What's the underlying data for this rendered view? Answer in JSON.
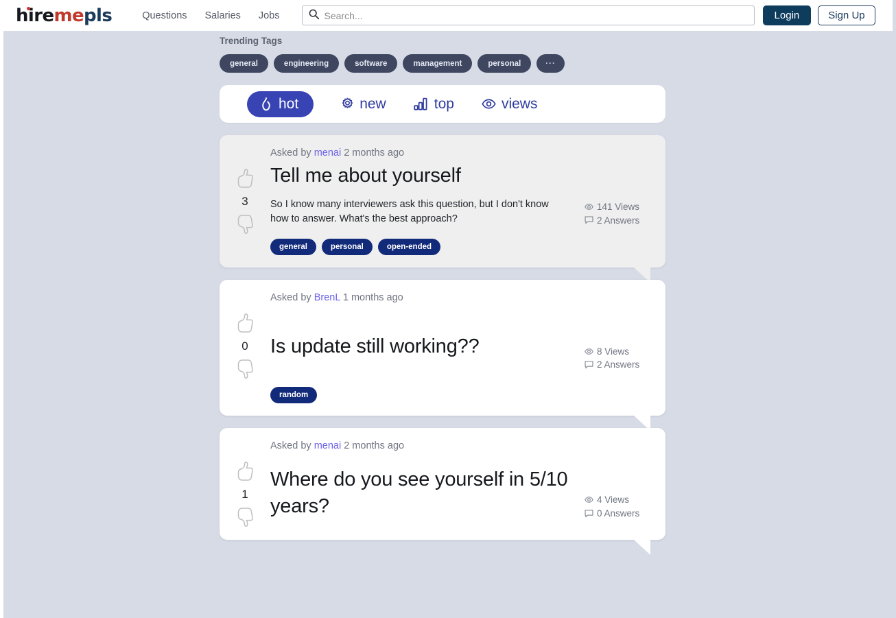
{
  "header": {
    "logo": {
      "part1": "hire",
      "part2": "me",
      "part3": "pls"
    },
    "nav": [
      {
        "label": "Questions"
      },
      {
        "label": "Salaries"
      },
      {
        "label": "Jobs"
      }
    ],
    "search": {
      "placeholder": "Search...",
      "value": "",
      "icon": "search-icon"
    },
    "login_label": "Login",
    "signup_label": "Sign Up",
    "colors": {
      "login_bg": "#0e3c5d",
      "signup_border": "#1b3a5c",
      "accent_red": "#c0392b"
    }
  },
  "trending": {
    "label": "Trending Tags",
    "tags": [
      {
        "label": "general"
      },
      {
        "label": "engineering"
      },
      {
        "label": "software"
      },
      {
        "label": "management"
      },
      {
        "label": "personal"
      },
      {
        "label": "···"
      }
    ],
    "pill_bg": "#3f4760"
  },
  "sort_tabs": {
    "active": "hot",
    "accent": "#3843b4",
    "items": [
      {
        "label": "hot",
        "icon": "flame-icon",
        "active": true
      },
      {
        "label": "new",
        "icon": "sparkle-icon",
        "active": false
      },
      {
        "label": "top",
        "icon": "bar-chart-icon",
        "active": false
      },
      {
        "label": "views",
        "icon": "eye-icon",
        "active": false
      }
    ]
  },
  "questions": [
    {
      "asked_prefix": "Asked by",
      "user": "menai",
      "time": "2 months ago",
      "title": "Tell me about yourself",
      "text": "So I know many interviewers ask this question, but I don't know how to answer. What's the best approach?",
      "votes": "3",
      "views": "141 Views",
      "answers": "2 Answers",
      "tags": [
        "general",
        "personal",
        "open-ended"
      ],
      "style": "shaded"
    },
    {
      "asked_prefix": "Asked by",
      "user": "BrenL",
      "time": "1 months ago",
      "title": "Is update still working??",
      "text": "",
      "votes": "0",
      "views": "8 Views",
      "answers": "2 Answers",
      "tags": [
        "random"
      ],
      "style": "plain"
    },
    {
      "asked_prefix": "Asked by",
      "user": "menai",
      "time": "2 months ago",
      "title": "Where do you see yourself in 5/10 years?",
      "text": "",
      "votes": "1",
      "views": "4 Views",
      "answers": "0 Answers",
      "tags": [],
      "style": "plain"
    }
  ],
  "icons": {
    "thumbs_up": "thumbs-up-icon",
    "thumbs_down": "thumbs-down-icon",
    "views": "eye-icon",
    "answers": "comment-icon"
  }
}
